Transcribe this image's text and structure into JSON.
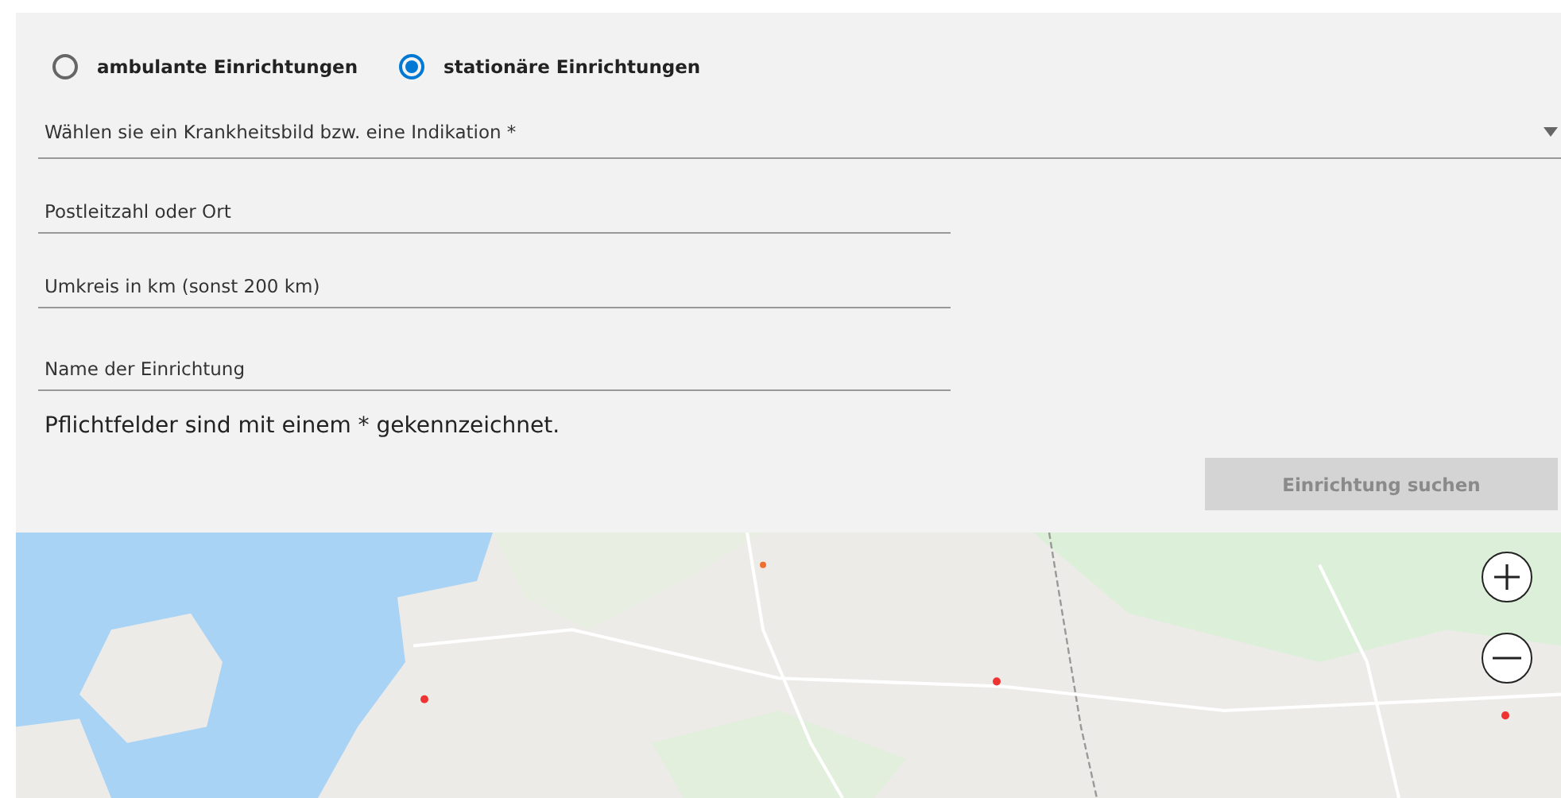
{
  "facility_type": [
    {
      "label": "ambulante Einrichtungen",
      "selected": false
    },
    {
      "label": "stationäre Einrichtungen",
      "selected": true
    }
  ],
  "indication_select": {
    "placeholder": "Wählen sie ein Krankheitsbild bzw. eine Indikation *"
  },
  "fields": [
    {
      "placeholder": "Postleitzahl oder Ort"
    },
    {
      "placeholder": "Umkreis in km (sonst 200 km)"
    },
    {
      "placeholder": "Name der Einrichtung"
    }
  ],
  "required_note": "Pflichtfelder sind mit einem * gekennzeichnet.",
  "search_button": {
    "label": "Einrichtung suchen",
    "disabled": true
  }
}
